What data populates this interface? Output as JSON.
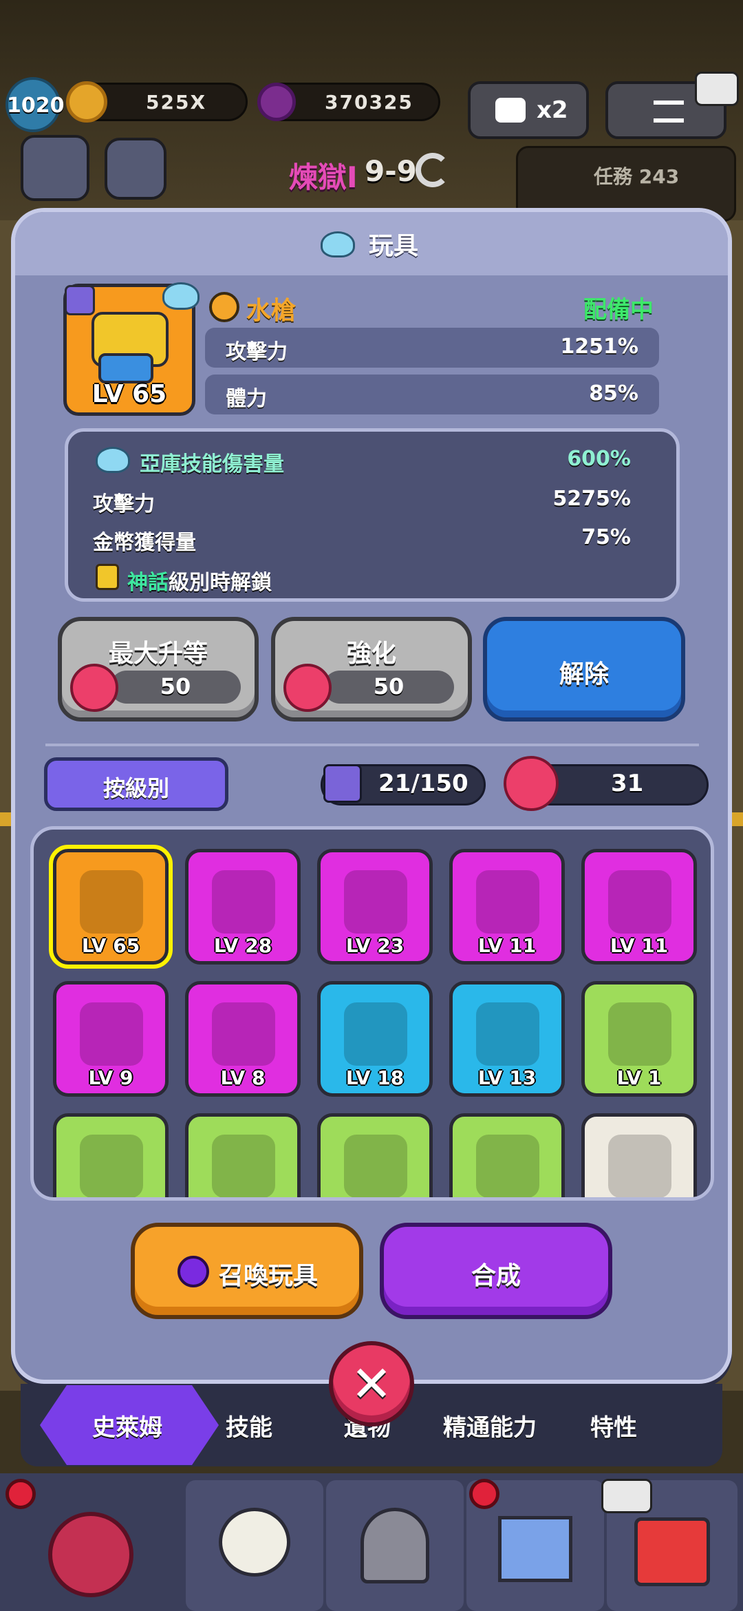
{
  "hud": {
    "player_level": "1020",
    "coins": "525X",
    "gems": "370325",
    "ad_multiplier": "x2",
    "stage_prefix": "煉獄I",
    "stage_number": "9-9",
    "mission_label": "任務 243"
  },
  "modal": {
    "title": "玩具",
    "item": {
      "level": "LV 65",
      "name": "水槍",
      "status": "配備中",
      "stats": [
        {
          "label": "攻擊力",
          "value": "1251%"
        },
        {
          "label": "體力",
          "value": "85%"
        }
      ]
    },
    "bonuses": {
      "skill_damage_label": "亞庫技能傷害量",
      "skill_damage_value": "600%",
      "attack_label": "攻擊力",
      "attack_value": "5275%",
      "gold_label": "金幣獲得量",
      "gold_value": "75%",
      "unlock_mythic": "神話",
      "unlock_rest": "級別時解鎖"
    },
    "buttons": {
      "max_upgrade_label": "最大升等",
      "max_upgrade_cost": "50",
      "enhance_label": "強化",
      "enhance_cost": "50",
      "unequip_label": "解除"
    },
    "sort_label": "按級別",
    "collection_count": "21/150",
    "key_count": "31",
    "toys": [
      {
        "level": "LV 65",
        "color": "orange"
      },
      {
        "level": "LV 28",
        "color": "magenta"
      },
      {
        "level": "LV 23",
        "color": "magenta"
      },
      {
        "level": "LV 11",
        "color": "magenta"
      },
      {
        "level": "LV 11",
        "color": "magenta"
      },
      {
        "level": "LV 9",
        "color": "magenta"
      },
      {
        "level": "LV 8",
        "color": "magenta"
      },
      {
        "level": "LV 18",
        "color": "cyan"
      },
      {
        "level": "LV 13",
        "color": "cyan"
      },
      {
        "level": "LV 1",
        "color": "green"
      },
      {
        "level": "",
        "color": "green"
      },
      {
        "level": "",
        "color": "green"
      },
      {
        "level": "",
        "color": "green"
      },
      {
        "level": "",
        "color": "green"
      },
      {
        "level": "",
        "color": "cream"
      }
    ],
    "summon_label": "召喚玩具",
    "merge_label": "合成",
    "close_label": "✕"
  },
  "tabs": [
    "史萊姆",
    "技能",
    "遺物",
    "精通能力",
    "特性"
  ],
  "colors": {
    "modal_bg": "#848bb5",
    "equipped_green": "#3ee86b",
    "item_name_orange": "#f4a62a",
    "unequip_blue": "#2e7fe0",
    "summon_orange": "#f7a22a",
    "merge_purple": "#a23ae8",
    "close_red": "#e83a64"
  }
}
